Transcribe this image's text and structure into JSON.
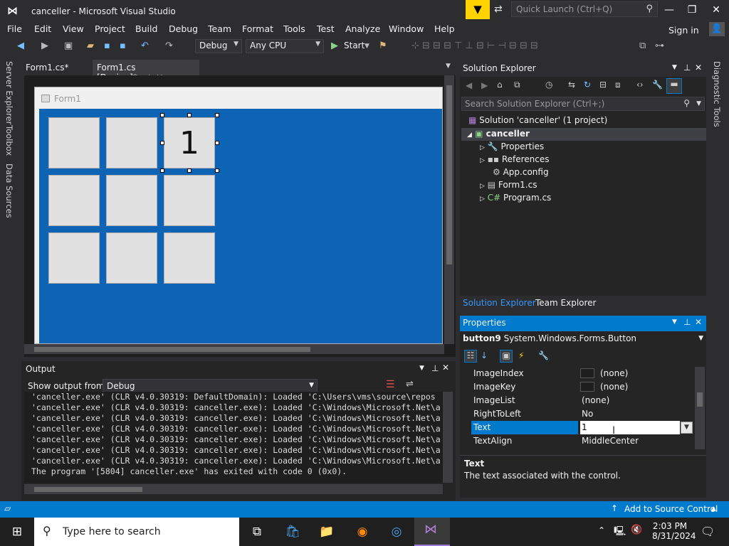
{
  "window": {
    "title": "canceller - Microsoft Visual Studio",
    "quick_launch_placeholder": "Quick Launch (Ctrl+Q)"
  },
  "menu": [
    "File",
    "Edit",
    "View",
    "Project",
    "Build",
    "Debug",
    "Team",
    "Format",
    "Tools",
    "Test",
    "Analyze",
    "Window",
    "Help"
  ],
  "signin": "Sign in",
  "toolbar": {
    "config": "Debug",
    "platform": "Any CPU",
    "start": "Start"
  },
  "left_tabs": [
    "Server Explorer",
    "Toolbox",
    "Data Sources"
  ],
  "right_tabs": [
    "Diagnostic Tools"
  ],
  "doc_tabs": [
    "Form1.cs*",
    "Form1.cs [Design]*"
  ],
  "designer": {
    "form_title": "Form1",
    "cells": [
      "",
      "",
      "1",
      "",
      "",
      "",
      "",
      "",
      ""
    ]
  },
  "output": {
    "title": "Output",
    "show_from_label": "Show output from:",
    "source": "Debug",
    "lines": [
      "'canceller.exe' (CLR v4.0.30319: DefaultDomain): Loaded 'C:\\Users\\vms\\source\\repos",
      "'canceller.exe' (CLR v4.0.30319: canceller.exe): Loaded 'C:\\Windows\\Microsoft.Net\\a",
      "'canceller.exe' (CLR v4.0.30319: canceller.exe): Loaded 'C:\\Windows\\Microsoft.Net\\a",
      "'canceller.exe' (CLR v4.0.30319: canceller.exe): Loaded 'C:\\Windows\\Microsoft.Net\\a",
      "'canceller.exe' (CLR v4.0.30319: canceller.exe): Loaded 'C:\\Windows\\Microsoft.Net\\a",
      "'canceller.exe' (CLR v4.0.30319: canceller.exe): Loaded 'C:\\Windows\\Microsoft.Net\\a",
      "'canceller.exe' (CLR v4.0.30319: canceller.exe): Loaded 'C:\\Windows\\Microsoft.Net\\a",
      "The program '[5804] canceller.exe' has exited with code 0 (0x0)."
    ]
  },
  "solution_explorer": {
    "title": "Solution Explorer",
    "search_placeholder": "Search Solution Explorer (Ctrl+;)",
    "solution": "Solution 'canceller' (1 project)",
    "project": "canceller",
    "items": [
      "Properties",
      "References",
      "App.config",
      "Form1.cs",
      "Program.cs"
    ],
    "tab_solution": "Solution Explorer",
    "tab_team": "Team Explorer"
  },
  "properties": {
    "title": "Properties",
    "object_name": "button9",
    "object_type": "System.Windows.Forms.Button",
    "rows": [
      {
        "name": "ImageIndex",
        "value": "(none)"
      },
      {
        "name": "ImageKey",
        "value": "(none)"
      },
      {
        "name": "ImageList",
        "value": "(none)"
      },
      {
        "name": "RightToLeft",
        "value": "No"
      },
      {
        "name": "Text",
        "value": "1"
      },
      {
        "name": "TextAlign",
        "value": "MiddleCenter"
      }
    ],
    "desc_title": "Text",
    "desc_text": "The text associated with the control."
  },
  "statusbar": {
    "source_control": "Add to Source Control"
  },
  "taskbar": {
    "search_placeholder": "Type here to search",
    "time": "2:03 PM",
    "date": "8/31/2024"
  },
  "colors": {
    "accent": "#007acc",
    "form_bg": "#0e64b4",
    "chrome": "#2d2d30"
  }
}
